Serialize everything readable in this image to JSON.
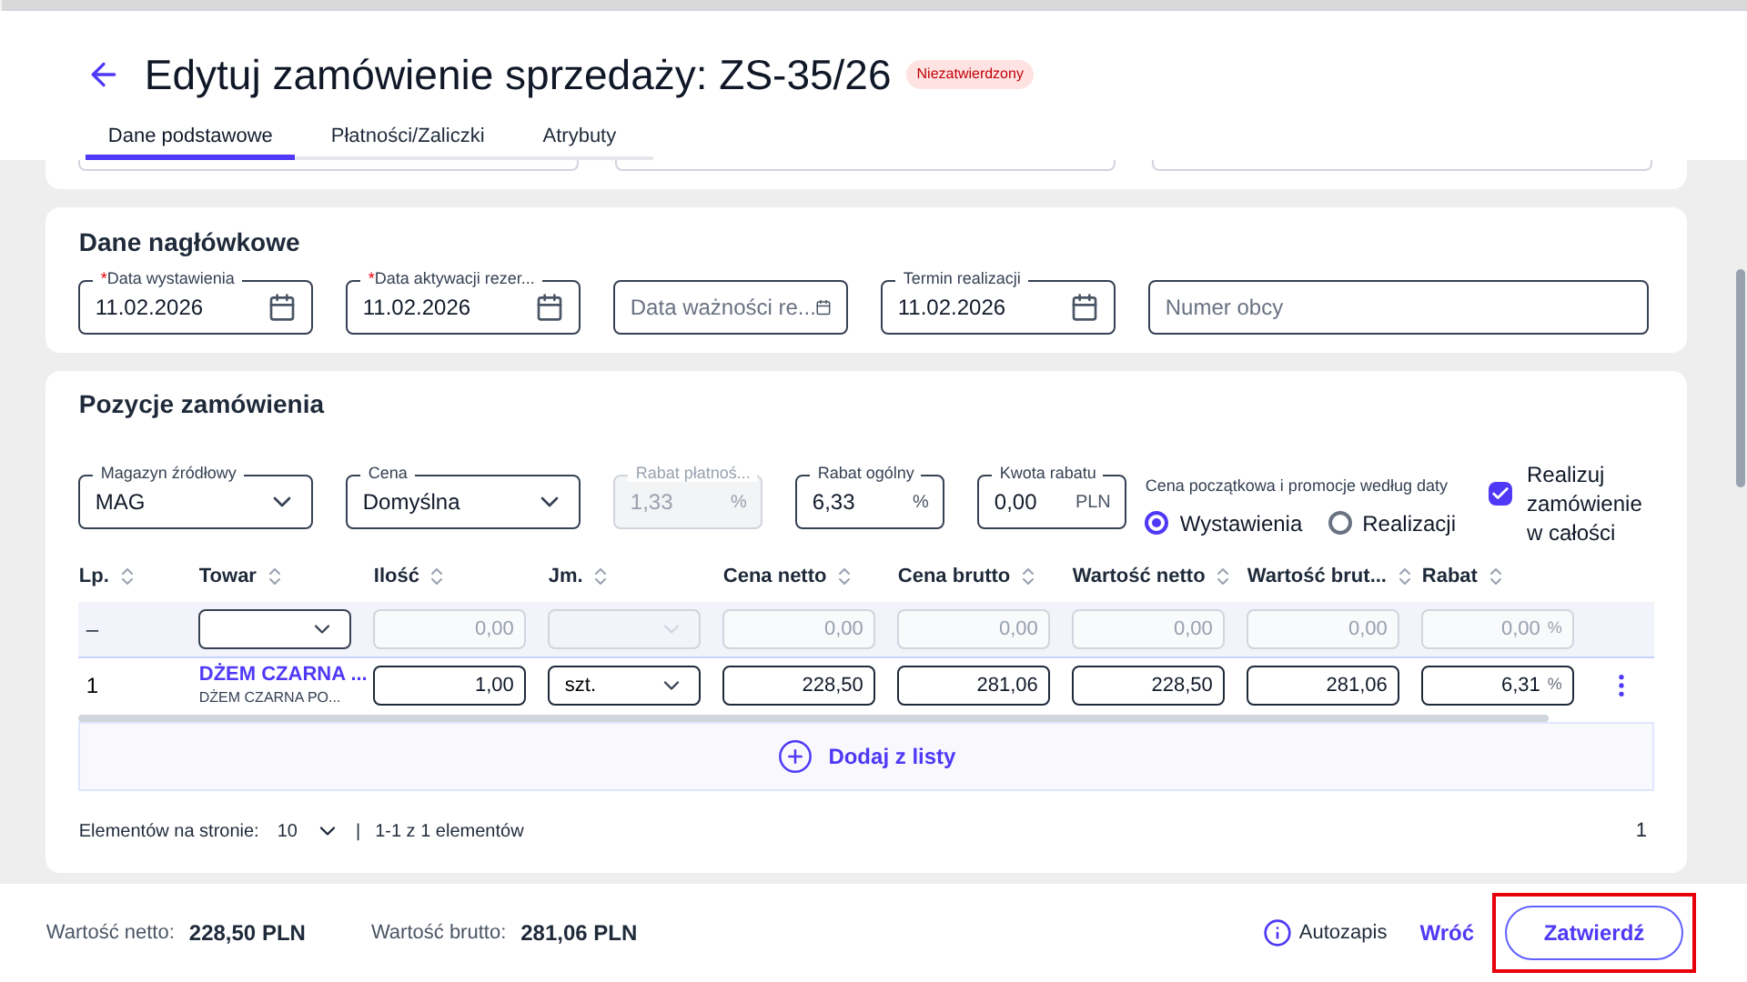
{
  "title": "Edytuj zamówienie sprzedaży: ZS-35/26",
  "status_badge": "Niezatwierdzony",
  "tabs": [
    {
      "label": "Dane podstawowe",
      "selected": true
    },
    {
      "label": "Płatności/Zaliczki",
      "selected": false
    },
    {
      "label": "Atrybuty",
      "selected": false
    }
  ],
  "header_section": {
    "title": "Dane nagłówkowe",
    "fields": [
      {
        "kind": "date",
        "label": "Data wystawienia",
        "required_mark": "*",
        "value": "11.02.2026"
      },
      {
        "kind": "date",
        "label": "Data aktywacji rezer...",
        "required_mark": "*",
        "value": "11.02.2026"
      },
      {
        "kind": "date",
        "placeholder": "Data ważności re..."
      },
      {
        "kind": "date",
        "label": "Termin realizacji",
        "value": "11.02.2026"
      },
      {
        "kind": "text",
        "placeholder": "Numer obcy"
      }
    ]
  },
  "positions": {
    "title": "Pozycje zamówienia",
    "fields": [
      {
        "kind": "select",
        "label": "Magazyn źródłowy",
        "value": "MAG",
        "disabled": false
      },
      {
        "kind": "select",
        "label": "Cena",
        "value": "Domyślna",
        "disabled": false
      },
      {
        "kind": "number",
        "label": "Rabat płatnoś...",
        "value": "1,33",
        "unit": "%",
        "disabled": true
      },
      {
        "kind": "number",
        "label": "Rabat ogólny",
        "value": "6,33",
        "unit": "%",
        "disabled": false
      },
      {
        "kind": "number",
        "label": "Kwota rabatu",
        "value": "0,00",
        "unit": "PLN",
        "disabled": false
      }
    ],
    "price_date": {
      "label": "Cena początkowa i promocje według daty",
      "options": [
        {
          "label": "Wystawienia",
          "selected": true
        },
        {
          "label": "Realizacji",
          "selected": false
        }
      ]
    },
    "realize_checkbox": {
      "label": "Realizuj zamówienie w całości",
      "checked": true
    },
    "table": {
      "columns": [
        "Lp.",
        "Towar",
        "Ilość",
        "Jm.",
        "Cena netto",
        "Cena brutto",
        "Wartość netto",
        "Wartość brut...",
        "Rabat"
      ],
      "filter_row": [
        {
          "kind": "text",
          "value": "–"
        },
        {
          "kind": "select"
        },
        {
          "kind": "input",
          "value": "0,00"
        },
        {
          "kind": "select",
          "disabled": true
        },
        {
          "kind": "input",
          "value": "0,00"
        },
        {
          "kind": "input",
          "value": "0,00"
        },
        {
          "kind": "input",
          "value": "0,00"
        },
        {
          "kind": "input",
          "value": "0,00"
        },
        {
          "kind": "input",
          "value": "0,00",
          "unit": "%"
        }
      ],
      "rows": [
        {
          "lp": "1",
          "name": "DŻEM CZARNA ...",
          "subtitle": "DŻEM CZARNA PO...",
          "quantity": "1,00",
          "unit": "szt.",
          "net_price": "228,50",
          "gross_price": "281,06",
          "net_value": "228,50",
          "gross_value": "281,06",
          "discount": "6,31",
          "discount_unit": "%"
        }
      ]
    },
    "add_button": "Dodaj z listy",
    "pagination": {
      "label": "Elementów na stronie:",
      "per_page": "10",
      "separator": "|",
      "range": "1-1 z 1 elementów",
      "page": "1"
    }
  },
  "footer": {
    "net_label": "Wartość netto:",
    "net_value": "228,50 PLN",
    "gross_label": "Wartość brutto:",
    "gross_value": "281,06 PLN",
    "autosave": "Autozapis",
    "back": "Wróć",
    "confirm": "Zatwierdź",
    "confirm_highlighted": true
  }
}
